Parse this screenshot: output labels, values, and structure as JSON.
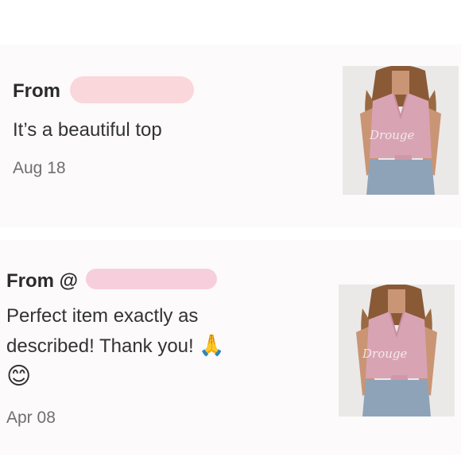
{
  "reviews": [
    {
      "from_label": "From",
      "message": "It’s a beautiful top",
      "date": "Aug 18",
      "watermark": "Drouge"
    },
    {
      "from_label": "From @",
      "message_line1": "Perfect item exactly as",
      "message_line2": "described! Thank you!",
      "emoji_pray": "🙏",
      "emoji_smile": "😊",
      "date": "Apr 08",
      "watermark": "Drouge"
    }
  ],
  "colors": {
    "card_bg": "#fcfafb",
    "redaction": "#f9d7db",
    "top_pink": "#d8a4b4"
  }
}
